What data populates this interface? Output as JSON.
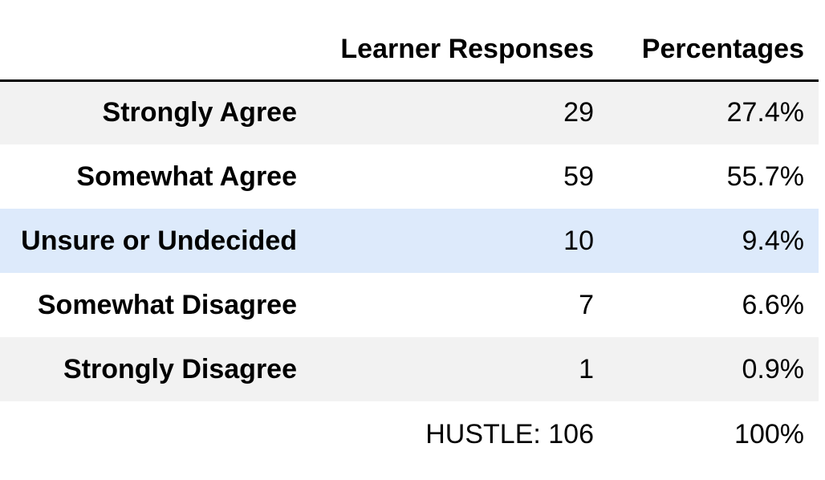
{
  "chart_data": {
    "type": "table",
    "columns": [
      "",
      "Learner Responses",
      "Percentages"
    ],
    "rows": [
      {
        "label": "Strongly Agree",
        "responses": "29",
        "percentage": "27.4%"
      },
      {
        "label": "Somewhat Agree",
        "responses": "59",
        "percentage": "55.7%"
      },
      {
        "label": "Unsure or Undecided",
        "responses": "10",
        "percentage": "9.4%"
      },
      {
        "label": "Somewhat Disagree",
        "responses": "7",
        "percentage": "6.6%"
      },
      {
        "label": "Strongly Disagree",
        "responses": "1",
        "percentage": "0.9%"
      }
    ],
    "total": {
      "label": "",
      "responses": "HUSTLE: 106",
      "percentage": "100%"
    },
    "highlighted_row": "Unsure or Undecided",
    "colors": {
      "stripe": "#f2f2f2",
      "highlight": "#ddeafb",
      "header_rule": "#000000"
    }
  }
}
